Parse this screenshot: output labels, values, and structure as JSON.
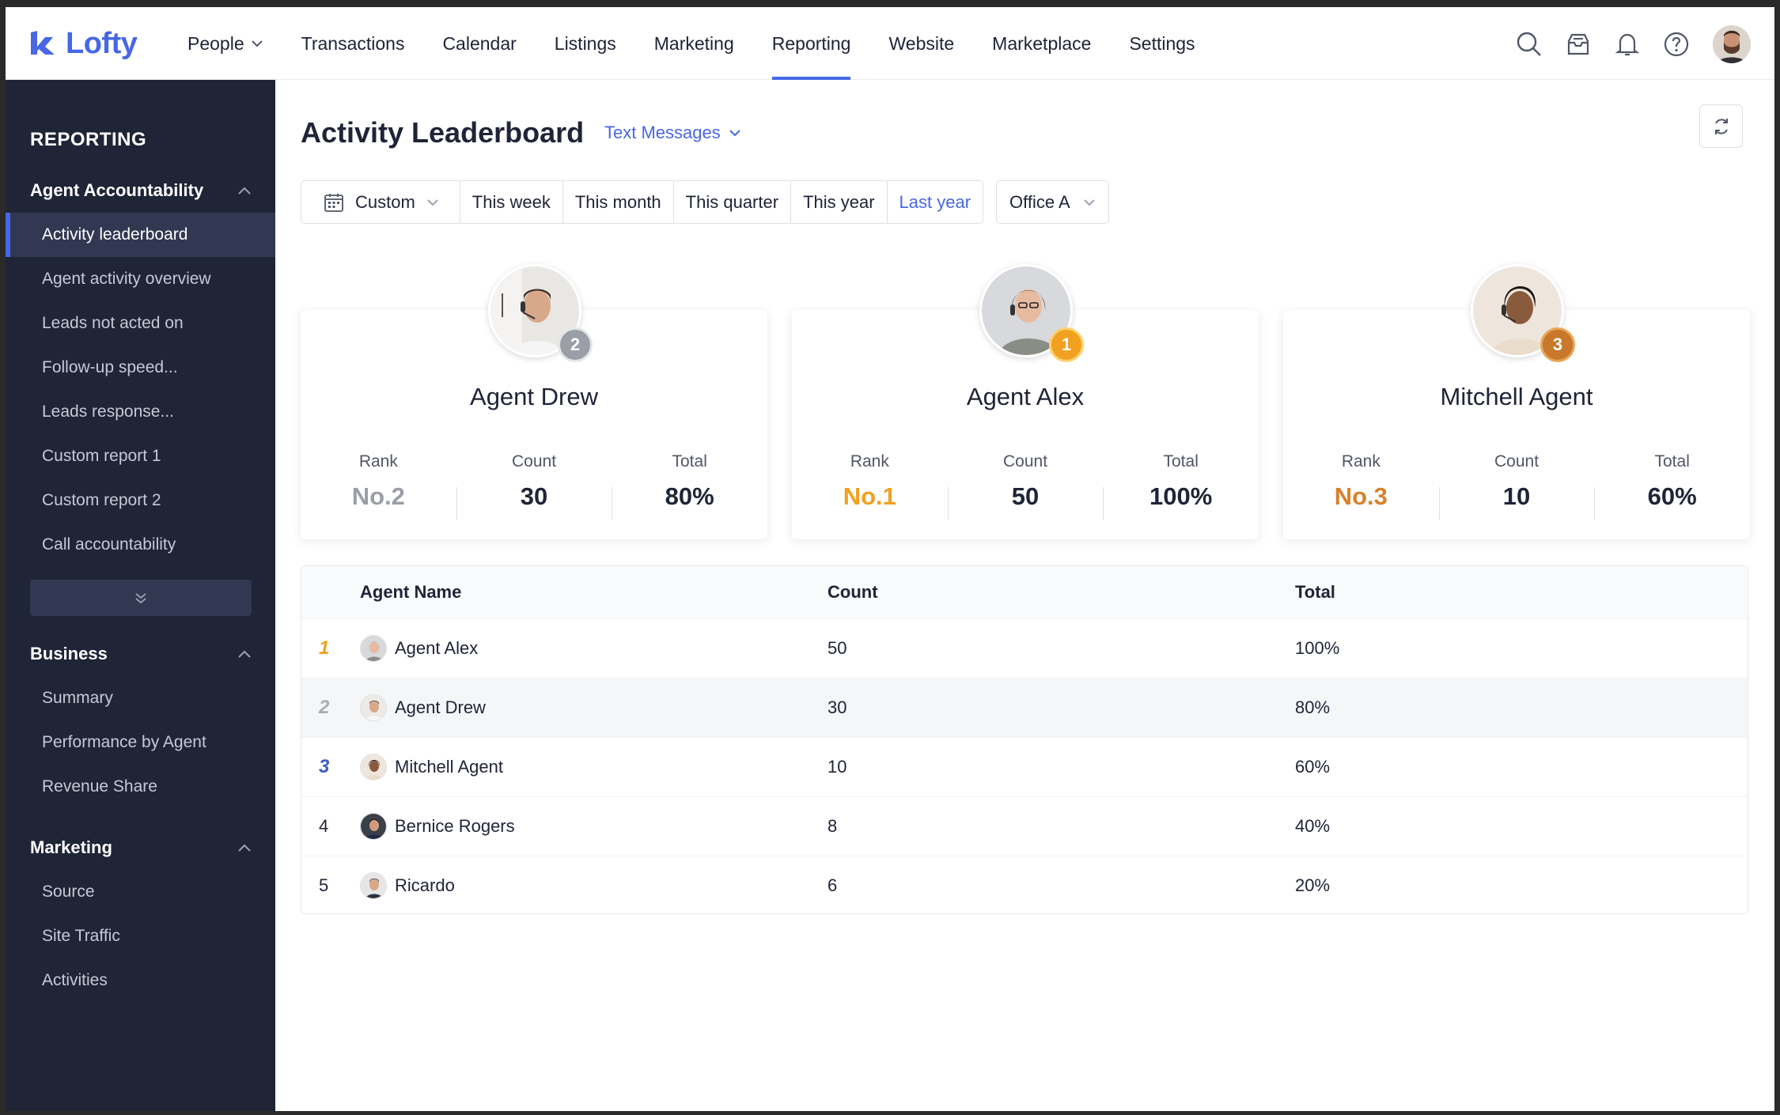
{
  "app": {
    "name": "Lofty",
    "brand_color": "#4767e6"
  },
  "nav": {
    "items": [
      {
        "label": "People",
        "has_dropdown": true,
        "active": false
      },
      {
        "label": "Transactions",
        "active": false
      },
      {
        "label": "Calendar",
        "active": false
      },
      {
        "label": "Listings",
        "active": false
      },
      {
        "label": "Marketing",
        "active": false
      },
      {
        "label": "Reporting",
        "active": true
      },
      {
        "label": "Website",
        "active": false
      },
      {
        "label": "Marketplace",
        "active": false
      },
      {
        "label": "Settings",
        "active": false
      }
    ],
    "icons": [
      "search-icon",
      "inbox-icon",
      "bell-icon",
      "help-icon",
      "user-avatar"
    ]
  },
  "sidebar": {
    "title": "REPORTING",
    "groups": [
      {
        "label": "Agent Accountability",
        "items": [
          "Activity leaderboard",
          "Agent activity overview",
          "Leads not acted on",
          "Follow-up speed...",
          "Leads response...",
          "Custom report 1",
          "Custom report 2",
          "Call accountability"
        ],
        "active_index": 0
      },
      {
        "label": "Business",
        "items": [
          "Summary",
          "Performance by Agent",
          "Revenue Share"
        ]
      },
      {
        "label": "Marketing",
        "items": [
          "Source",
          "Site Traffic",
          "Activities"
        ]
      }
    ]
  },
  "page": {
    "title": "Activity Leaderboard",
    "type_select": "Text Messages",
    "filters": {
      "custom_label": "Custom",
      "ranges": [
        "This week",
        "This month",
        "This quarter",
        "This year",
        "Last year"
      ],
      "active_range": "Last year",
      "office": "Office A"
    }
  },
  "podium": {
    "labels": {
      "rank": "Rank",
      "count": "Count",
      "total": "Total"
    },
    "cards": [
      {
        "name": "Agent Drew",
        "medal": "2",
        "rank": "No.2",
        "count": "30",
        "total": "80%",
        "medal_color": "#9b9ea6",
        "rank_color": "#9b9ea6"
      },
      {
        "name": "Agent Alex",
        "medal": "1",
        "rank": "No.1",
        "count": "50",
        "total": "100%",
        "medal_color": "#f2a01f",
        "rank_color": "#f2a01f"
      },
      {
        "name": "Mitchell Agent",
        "medal": "3",
        "rank": "No.3",
        "count": "10",
        "total": "60%",
        "medal_color": "#c7782a",
        "rank_color": "#d7822c"
      }
    ]
  },
  "table": {
    "headers": {
      "name": "Agent Name",
      "count": "Count",
      "total": "Total"
    },
    "rows": [
      {
        "rank": "1",
        "name": "Agent Alex",
        "count": "50",
        "total": "100%",
        "rank_color": "#f2a01f"
      },
      {
        "rank": "2",
        "name": "Agent Drew",
        "count": "30",
        "total": "80%",
        "rank_color": "#a8abb3"
      },
      {
        "rank": "3",
        "name": "Mitchell Agent",
        "count": "10",
        "total": "60%",
        "rank_color": "#3f5bc6"
      },
      {
        "rank": "4",
        "name": "Bernice Rogers",
        "count": "8",
        "total": "40%",
        "rank_color": "#202437"
      },
      {
        "rank": "5",
        "name": "Ricardo",
        "count": "6",
        "total": "20%",
        "rank_color": "#202437"
      }
    ]
  }
}
